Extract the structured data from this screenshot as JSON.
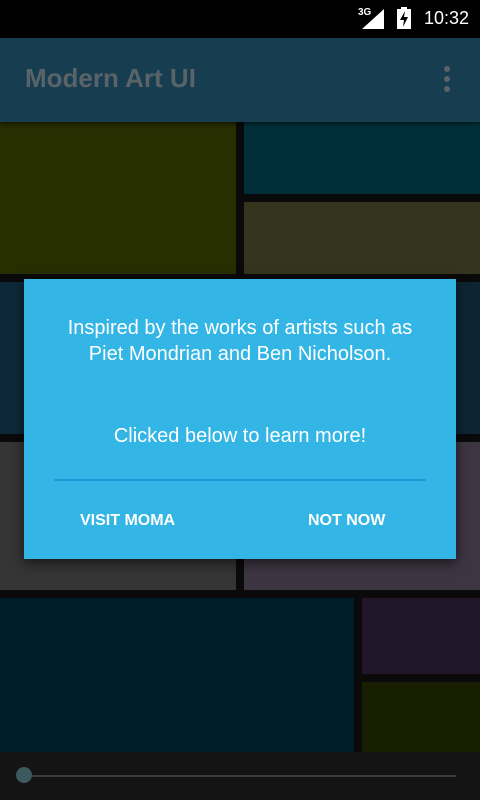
{
  "status_bar": {
    "network": "3G",
    "time": "10:32"
  },
  "action_bar": {
    "title": "Modern Art UI",
    "overflow_icon": "overflow-menu-icon"
  },
  "artwork": {
    "tile_colors": [
      "#4e5c00",
      "#005f73",
      "#6b6a3e",
      "#1a5372",
      "#1a4a66",
      "#6a6a6a",
      "#7c6a86",
      "#003a55",
      "#452c55",
      "#2f3f00"
    ]
  },
  "dialog": {
    "message": "Inspired by the works of artists such as Piet Mondrian and Ben Nicholson.",
    "prompt": "Clicked below to learn more!",
    "positive_button": "VISIT MOMA",
    "negative_button": "NOT NOW",
    "background_color": "#33b5e5",
    "divider_color": "#1f97d6"
  },
  "seek_bar": {
    "progress": 0
  }
}
